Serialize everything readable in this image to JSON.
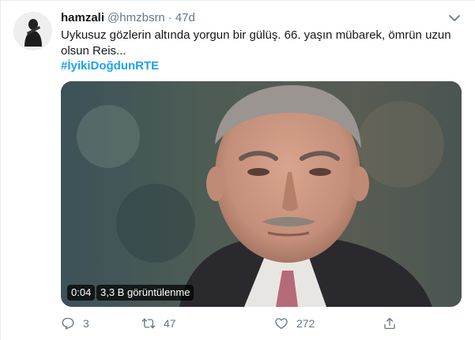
{
  "tweet": {
    "author_name": "hamzali",
    "handle": "@hmzbsrn",
    "separator": "·",
    "time": "47d",
    "text": "Uykusuz gözlerin altında yorgun bir gülüş. 66. yaşın mübarek, ömrün uzun olsun Reis...",
    "hashtag": "#İyikiDoğdunRTE"
  },
  "video": {
    "duration": "0:04",
    "views": "3,3 B görüntülenme"
  },
  "actions": {
    "reply_icon": "reply-icon",
    "reply_count": "3",
    "retweet_icon": "retweet-icon",
    "retweet_count": "47",
    "like_icon": "heart-icon",
    "like_count": "272",
    "share_icon": "share-icon"
  },
  "colors": {
    "link": "#1da1f2",
    "secondary_text": "#657786",
    "primary_text": "#14171a",
    "border": "#e6ecf0"
  }
}
